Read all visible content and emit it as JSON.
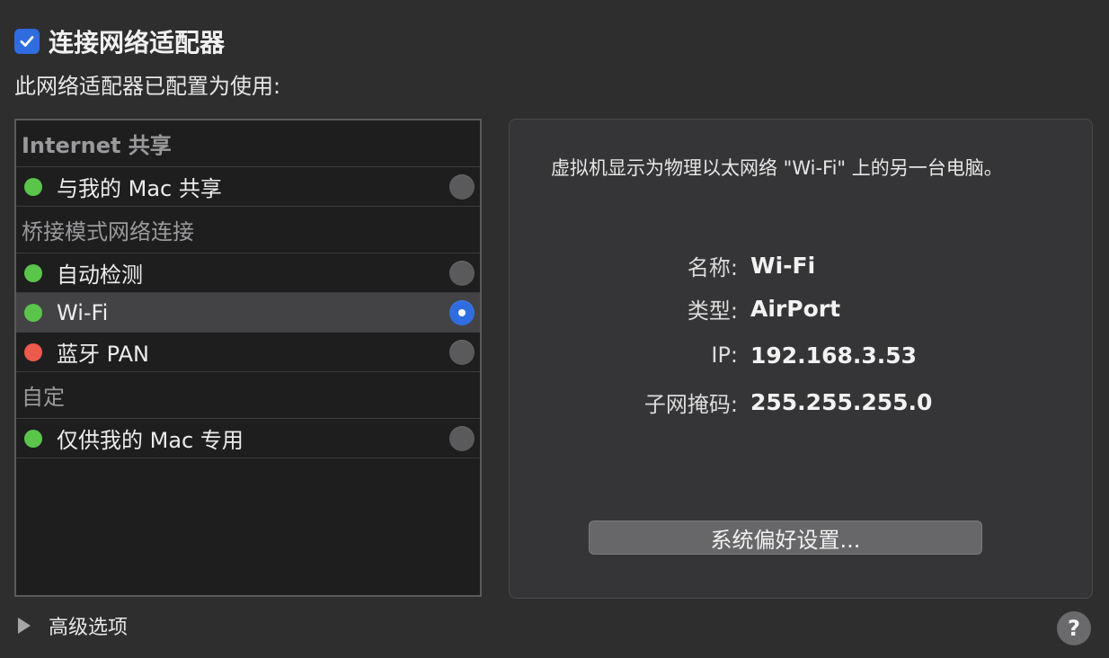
{
  "connect": {
    "label": "连接网络适配器",
    "checked": true
  },
  "subtitle": "此网络适配器已配置为使用:",
  "list": {
    "sections": [
      {
        "header": "Internet 共享",
        "items": [
          {
            "label": "与我的 Mac 共享",
            "status": "green",
            "selected": false
          }
        ]
      },
      {
        "header": "桥接模式网络连接",
        "items": [
          {
            "label": "自动检测",
            "status": "green",
            "selected": false
          },
          {
            "label": "Wi-Fi",
            "status": "green",
            "selected": true
          },
          {
            "label": "蓝牙 PAN",
            "status": "red",
            "selected": false
          }
        ]
      },
      {
        "header": "自定",
        "items": [
          {
            "label": "仅供我的 Mac 专用",
            "status": "green",
            "selected": false
          }
        ]
      }
    ]
  },
  "details": {
    "description": "虚拟机显示为物理以太网络 \"Wi-Fi\" 上的另一台电脑。",
    "name_key": "名称:",
    "name_value": "Wi-Fi",
    "type_key": "类型:",
    "type_value": "AirPort",
    "ip_key": "IP:",
    "ip_value": "192.168.3.53",
    "mask_key": "子网掩码:",
    "mask_value": "255.255.255.0",
    "pref_button": "系统偏好设置..."
  },
  "advanced_label": "高级选项",
  "help_label": "?",
  "colors": {
    "green": "#5ac44b",
    "red": "#ec5a4d",
    "accent": "#2f6ce0"
  }
}
